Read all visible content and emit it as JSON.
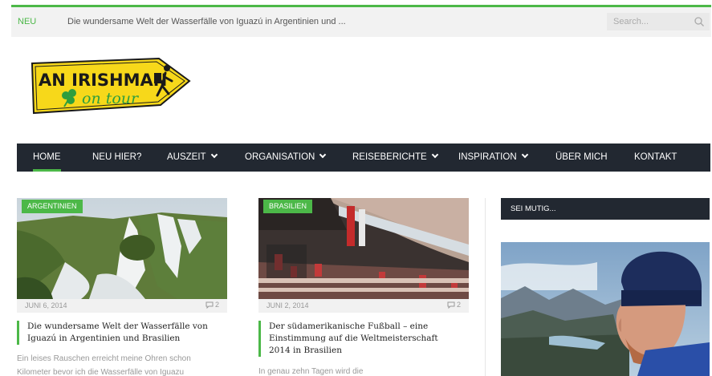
{
  "topbar": {
    "label": "NEU",
    "headline": "Die wundersame Welt der Wasserfälle von Iguazú in Argentinien und ...",
    "search_placeholder": "Search..."
  },
  "logo": {
    "line1": "AN IRISHMAN",
    "line2": "on tour"
  },
  "nav": {
    "items": [
      {
        "label": "HOME",
        "dropdown": false,
        "active": true
      },
      {
        "label": "NEU HIER?",
        "dropdown": false
      },
      {
        "label": "AUSZEIT",
        "dropdown": true
      },
      {
        "label": "ORGANISATION",
        "dropdown": true
      },
      {
        "label": "REISEBERICHTE",
        "dropdown": true
      },
      {
        "label": "INSPIRATION",
        "dropdown": true
      },
      {
        "label": "ÜBER MICH",
        "dropdown": false
      },
      {
        "label": "KONTAKT",
        "dropdown": false
      }
    ]
  },
  "posts": [
    {
      "category": "ARGENTINIEN",
      "date": "JUNI 6, 2014",
      "comments": "2",
      "title": "Die wundersame Welt der Wasserfälle von Iguazú in Argentinien und Brasilien",
      "excerpt_line1": "Ein leises Rauschen erreicht meine Ohren schon",
      "excerpt_line2": "Kilometer bevor ich die Wasserfälle von Iguazu"
    },
    {
      "category": "BRASILIEN",
      "date": "JUNI 2, 2014",
      "comments": "2",
      "title": "Der südamerikanische Fußball – eine Einstimmung auf die Weltmeisterschaft 2014 in Brasilien",
      "excerpt_line1": "In genau zehn Tagen wird die",
      "excerpt_line2": ""
    }
  ],
  "sidebar": {
    "widget_title": "SEI MUTIG..."
  },
  "colors": {
    "accent": "#4cb848",
    "nav_bg": "#222831",
    "logo_yellow": "#f7d81a"
  }
}
